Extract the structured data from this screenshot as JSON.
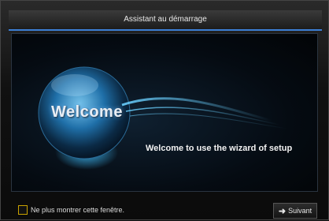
{
  "window": {
    "title": "Assistant au démarrage"
  },
  "hero": {
    "badge_text": "Welcome",
    "message": "Welcome to use the wizard of setup"
  },
  "footer": {
    "checkbox_label": "Ne plus montrer cette fenêtre.",
    "checkbox_checked": false,
    "next_label": "Suivant",
    "next_icon": "arrow-right-icon"
  },
  "colors": {
    "accent": "#3c7fd6",
    "checkbox_border": "#c9a200",
    "orb": "#2aa8e8"
  }
}
